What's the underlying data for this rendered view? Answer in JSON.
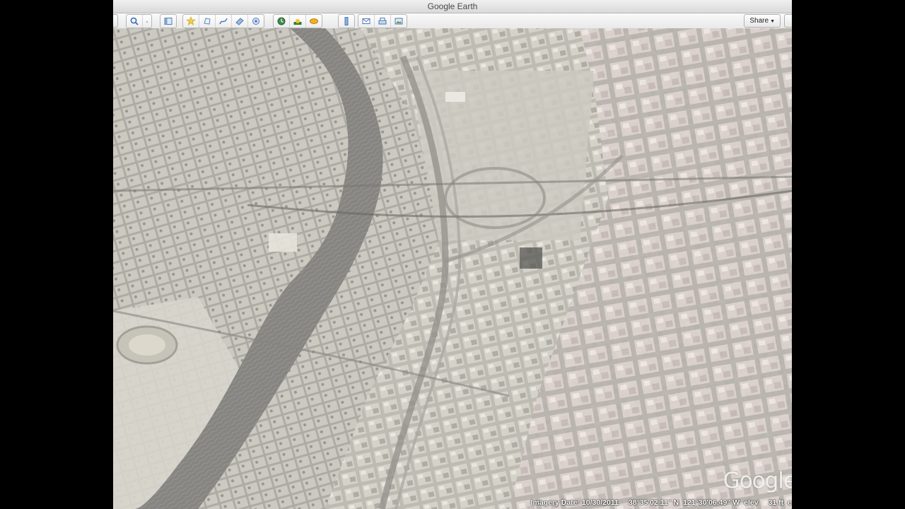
{
  "window": {
    "title": "Google Earth"
  },
  "toolbar": {
    "buttons": [
      {
        "icon": "sidebar-icon"
      },
      {
        "icon": "search-icon"
      },
      {
        "icon": "hide-sidebar-icon"
      },
      {
        "icon": "placemark-icon"
      },
      {
        "icon": "polygon-icon"
      },
      {
        "icon": "path-icon"
      },
      {
        "icon": "image-overlay-icon"
      },
      {
        "icon": "record-tour-icon"
      },
      {
        "icon": "historical-imagery-icon"
      },
      {
        "icon": "sun-icon"
      },
      {
        "icon": "planets-icon"
      },
      {
        "icon": "ruler-icon"
      },
      {
        "icon": "email-icon"
      },
      {
        "icon": "print-icon"
      },
      {
        "icon": "save-image-icon"
      }
    ],
    "share_label": "Share"
  },
  "status": {
    "imagery_date": "Imagery Date: 10/30/2011",
    "lat": "38°35'02.11\" N",
    "lon": "121°30'06.49\" W",
    "elev_label": "elev",
    "elev_value": "31 ft",
    "eye_alt_cut": "e"
  },
  "map": {
    "logo": "Google"
  }
}
